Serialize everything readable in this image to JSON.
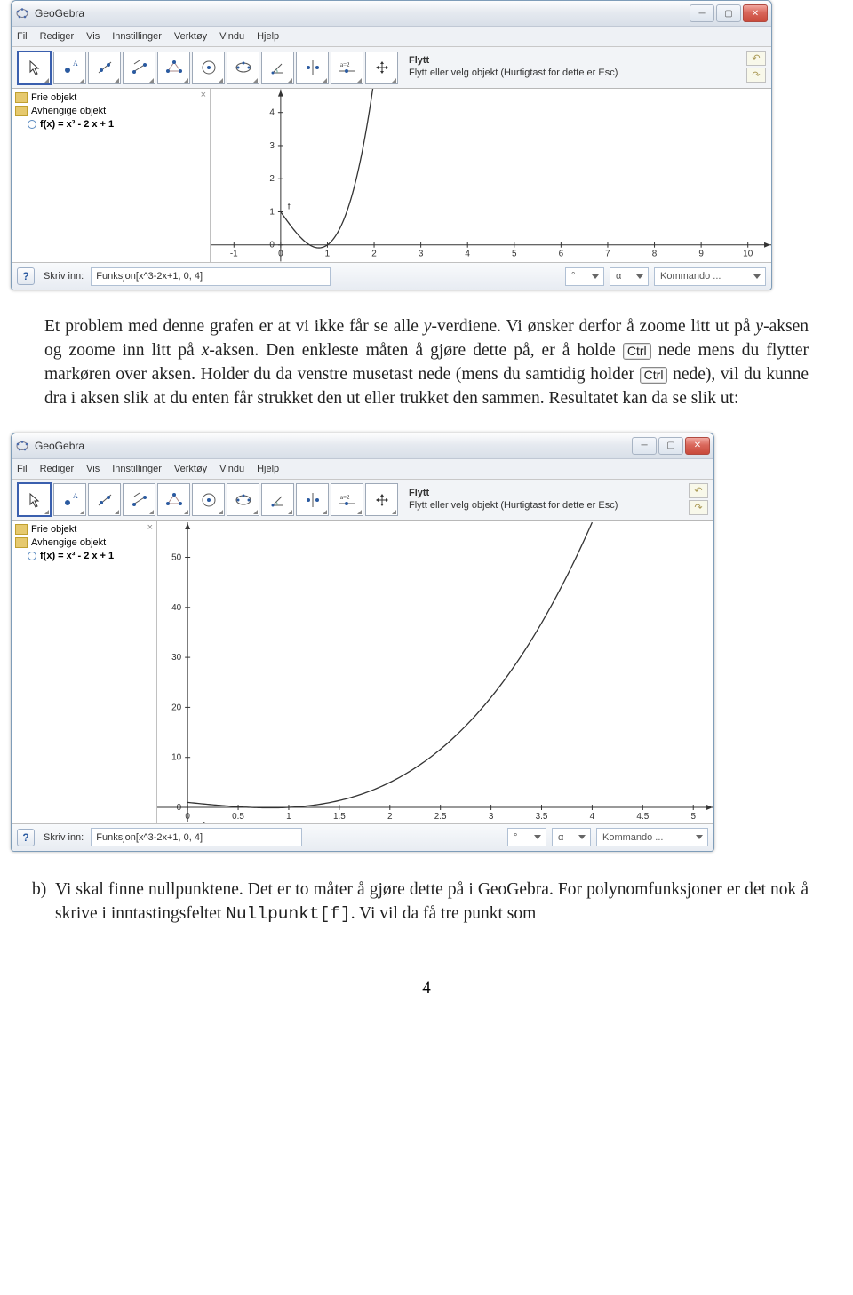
{
  "app": {
    "title": "GeoGebra",
    "menus": [
      "Fil",
      "Rediger",
      "Vis",
      "Innstillinger",
      "Verktøy",
      "Vindu",
      "Hjelp"
    ],
    "tool_name": "Flytt",
    "tool_desc": "Flytt eller velg objekt (Hurtigtast for dette er Esc)"
  },
  "algebra": {
    "free_label": "Frie objekt",
    "dep_label": "Avhengige objekt",
    "fn_label": "f(x) = x³ - 2 x + 1"
  },
  "bottom1": {
    "input_label": "Skriv inn:",
    "input_value": "Funksjon[x^3-2x+1, 0, 4]",
    "dd1": "°",
    "dd2": "α",
    "dd3": "Kommando ..."
  },
  "bottom2": {
    "input_label": "Skriv inn:",
    "input_value": "Funksjon[x^3-2x+1, 0, 4]",
    "dd1": "°",
    "dd2": "α",
    "dd3": "Kommando ..."
  },
  "chart_data": [
    {
      "type": "line",
      "label": "f",
      "function": "x^3 - 2x + 1",
      "series": [
        {
          "name": "f",
          "x": [
            0,
            0.5,
            1,
            1.5,
            2
          ],
          "y": [
            1,
            0.125,
            0,
            1.375,
            5
          ]
        }
      ],
      "xlim": [
        -1.5,
        10.5
      ],
      "ylim": [
        -0.5,
        4.7
      ],
      "xticks": [
        -1,
        0,
        1,
        2,
        3,
        4,
        5,
        6,
        7,
        8,
        9,
        10
      ],
      "yticks": [
        0,
        1,
        2,
        3,
        4
      ]
    },
    {
      "type": "line",
      "label": "f",
      "function": "x^3 - 2x + 1",
      "series": [
        {
          "name": "f",
          "x": [
            0,
            0.5,
            1,
            1.5,
            2,
            2.5,
            3,
            3.5,
            4
          ],
          "y": [
            1,
            0.125,
            0,
            1.375,
            5,
            12.125,
            22,
            36.875,
            57
          ]
        }
      ],
      "xlim": [
        -0.3,
        5.2
      ],
      "ylim": [
        -3,
        57
      ],
      "xticks": [
        0,
        0.5,
        1,
        1.5,
        2,
        2.5,
        3,
        3.5,
        4,
        4.5,
        5
      ],
      "yticks": [
        0,
        10,
        20,
        30,
        40,
        50
      ]
    }
  ],
  "text": {
    "para1a": "Et problem med denne grafen er at vi ikke får se alle ",
    "para1b": "-verdiene. Vi ønsker derfor å zoome litt ut på ",
    "para1c": "-aksen og zoome inn litt på ",
    "para1d": "-aksen. Den enkleste måten å gjøre dette på, er å holde ",
    "ctrl": "Ctrl",
    "para1e": " nede mens du flytter markøren over aksen. Holder du da venstre musetast nede (mens du samtidig holder ",
    "para1f": " nede), vil du kunne dra i aksen slik at du enten får strukket den ut eller trukket den sammen. Resultatet kan da se slik ut:",
    "itemb_marker": "b)",
    "itemb": "Vi skal finne nullpunktene. Det er to måter å gjøre dette på i GeoGebra. For polynomfunksjoner er det nok å skrive i inntastingsfeltet ",
    "itemb_code": "Nullpunkt[f]",
    "itemb_tail": ". Vi vil da få tre punkt som",
    "y": "y",
    "x": "x",
    "pagenum": "4"
  }
}
